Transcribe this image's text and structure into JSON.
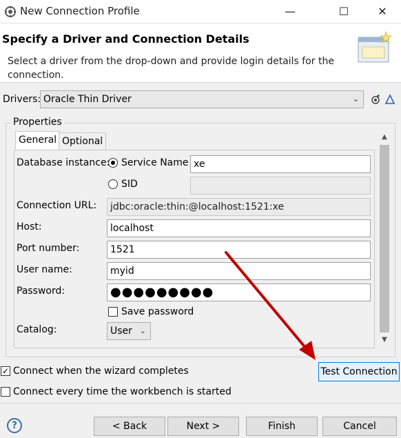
{
  "window": {
    "title": "New Connection Profile",
    "minimize_glyph": "—",
    "maximize_glyph": "☐",
    "close_glyph": "✕"
  },
  "header": {
    "title": "Specify a Driver and Connection Details",
    "description": "Select a driver from the drop-down and provide login details for the connection."
  },
  "drivers": {
    "label": "Drivers:",
    "selected": "Oracle Thin Driver",
    "new_driver_icon": "new-driver-icon",
    "edit_driver_icon": "edit-driver-icon"
  },
  "properties": {
    "group_label": "Properties",
    "tabs": [
      {
        "label": "General"
      },
      {
        "label": "Optional"
      }
    ]
  },
  "form": {
    "database_instance_label": "Database instance:",
    "service_name_label": "Service Name",
    "service_name_value": "xe",
    "sid_label": "SID",
    "sid_value": "",
    "connection_url_label": "Connection URL:",
    "connection_url_value": "jdbc:oracle:thin:@localhost:1521:xe",
    "host_label": "Host:",
    "host_value": "localhost",
    "port_label": "Port number:",
    "port_value": "1521",
    "user_label": "User name:",
    "user_value": "myid",
    "password_label": "Password:",
    "password_value": "●●●●●●●●●",
    "save_password_label": "Save password",
    "catalog_label": "Catalog:",
    "catalog_value": "User"
  },
  "options": {
    "connect_when_complete_label": "Connect when the wizard completes",
    "connect_every_time_label": "Connect every time the workbench is started",
    "test_connection_label": "Test Connection"
  },
  "footer": {
    "help_glyph": "?",
    "back_label": "< Back",
    "next_label": "Next >",
    "finish_label": "Finish",
    "cancel_label": "Cancel"
  },
  "annotation": {
    "arrow_color": "#c00000"
  }
}
